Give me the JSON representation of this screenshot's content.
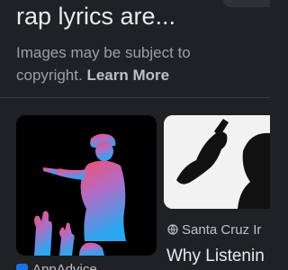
{
  "header": {
    "title": "rap lyrics are..."
  },
  "notice": {
    "text": "Images may be subject to copyright.",
    "link_label": "Learn More"
  },
  "results": [
    {
      "source": "AppAdvice",
      "caption": "",
      "icon": "app-favicon-icon"
    },
    {
      "source": "Santa Cruz Ir",
      "caption": "Why Listenin",
      "icon": "globe-icon"
    }
  ],
  "colors": {
    "background": "#202124",
    "title": "#e8eaed",
    "muted_text": "#9aa0a6",
    "gradient_top": "#f0506e",
    "gradient_bottom": "#2aa7f0"
  }
}
